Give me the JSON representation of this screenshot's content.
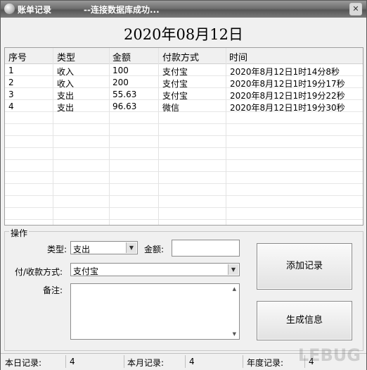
{
  "window": {
    "title": "账单记录",
    "status_text": "--连接数据库成功...",
    "close_glyph": "✕"
  },
  "date_heading": "2020年08月12日",
  "table": {
    "columns": [
      "序号",
      "类型",
      "金额",
      "付款方式",
      "时间"
    ],
    "rows": [
      [
        "1",
        "收入",
        "100",
        "支付宝",
        "2020年8月12日1时14分8秒"
      ],
      [
        "2",
        "收入",
        "200",
        "支付宝",
        "2020年8月12日1时19分17秒"
      ],
      [
        "3",
        "支出",
        "55.63",
        "支付宝",
        "2020年8月12日1时19分22秒"
      ],
      [
        "4",
        "支出",
        "96.63",
        "微信",
        "2020年8月12日1时19分30秒"
      ]
    ]
  },
  "operation": {
    "group_label": "操作",
    "type_label": "类型:",
    "type_value": "支出",
    "amount_label": "金额:",
    "amount_value": "",
    "payment_label": "付/收款方式:",
    "payment_value": "支付宝",
    "note_label": "备注:",
    "note_value": "",
    "add_button": "添加记录",
    "generate_button": "生成信息"
  },
  "statusbar": {
    "today_label": "本日记录:",
    "today_count": "4",
    "month_label": "本月记录:",
    "month_count": "4",
    "year_label": "年度记录:",
    "year_count": "4"
  },
  "watermark": "LEBUG"
}
